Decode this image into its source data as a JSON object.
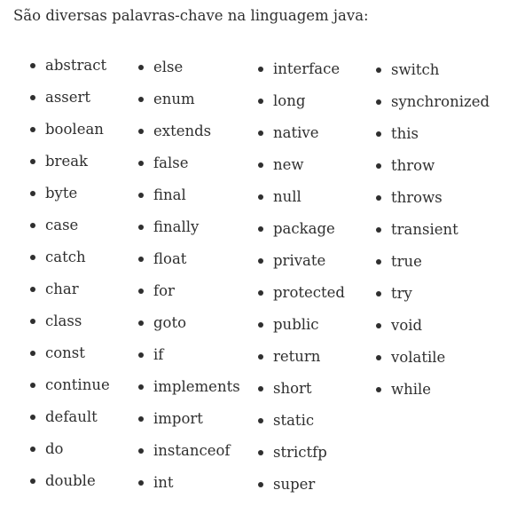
{
  "intro": "São diversas palavras-chave na linguagem java:",
  "columns": [
    [
      "abstract",
      "assert",
      "boolean",
      "break",
      "byte",
      "case",
      "catch",
      "char",
      "class",
      "const",
      "continue",
      "default",
      "do",
      "double"
    ],
    [
      "else",
      "enum",
      "extends",
      "false",
      "final",
      "finally",
      "float",
      "for",
      "goto",
      "if",
      "implements",
      "import",
      "instanceof",
      "int"
    ],
    [
      "interface",
      "long",
      "native",
      "new",
      "null",
      "package",
      "private",
      "protected",
      "public",
      "return",
      "short",
      "static",
      "strictfp",
      "super"
    ],
    [
      "switch",
      "synchronized",
      "this",
      "throw",
      "throws",
      "transient",
      "true",
      "try",
      "void",
      "volatile",
      "while"
    ]
  ]
}
